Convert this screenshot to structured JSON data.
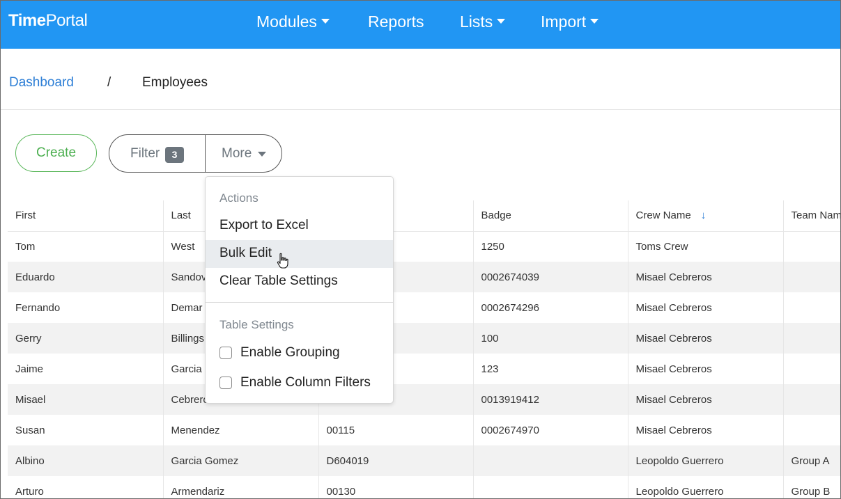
{
  "brand": {
    "bold": "Time",
    "light": "Portal"
  },
  "nav": {
    "modules": "Modules",
    "reports": "Reports",
    "lists": "Lists",
    "import": "Import"
  },
  "breadcrumb": {
    "root": "Dashboard",
    "separator": "/",
    "current": "Employees"
  },
  "toolbar": {
    "create_label": "Create",
    "filter_label": "Filter",
    "filter_count": "3",
    "more_label": "More"
  },
  "table": {
    "headers": [
      "First",
      "Last",
      "",
      "Badge",
      "Crew Name",
      "Team Nam"
    ],
    "sort_column": "Crew Name",
    "rows": [
      [
        "Tom",
        "West",
        "",
        "1250",
        "Toms Crew",
        ""
      ],
      [
        "Eduardo",
        "Sandov",
        "",
        "0002674039",
        "Misael Cebreros",
        ""
      ],
      [
        "Fernando",
        "Demar",
        "",
        "0002674296",
        "Misael Cebreros",
        ""
      ],
      [
        "Gerry",
        "Billings",
        "",
        "100",
        "Misael Cebreros",
        ""
      ],
      [
        "Jaime",
        "Garcia",
        "",
        "123",
        "Misael Cebreros",
        ""
      ],
      [
        "Misael",
        "Cebrero",
        "",
        "0013919412",
        "Misael Cebreros",
        ""
      ],
      [
        "Susan",
        "Menendez",
        "00115",
        "0002674970",
        "Misael Cebreros",
        ""
      ],
      [
        "Albino",
        "Garcia Gomez",
        "D604019",
        "",
        "Leopoldo Guerrero",
        "Group A"
      ],
      [
        "Arturo",
        "Armendariz",
        "00130",
        "",
        "Leopoldo Guerrero",
        "Group B"
      ]
    ]
  },
  "dropdown": {
    "actions_header": "Actions",
    "export_excel": "Export to Excel",
    "bulk_edit": "Bulk Edit",
    "clear_settings": "Clear Table Settings",
    "table_settings_header": "Table Settings",
    "enable_grouping": "Enable Grouping",
    "enable_column_filters": "Enable Column Filters",
    "hovered_item": "Bulk Edit"
  },
  "colors": {
    "navbar": "#2196f3",
    "link": "#2e7fd6",
    "create_green": "#4caf50",
    "badge_gray": "#6c757d"
  }
}
